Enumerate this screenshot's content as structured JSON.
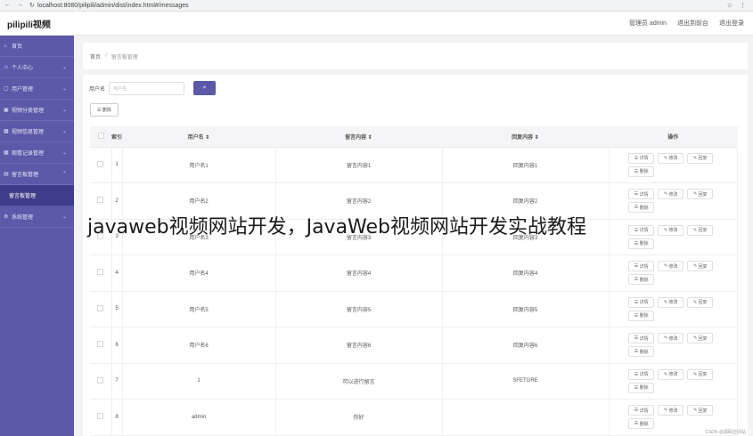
{
  "browser": {
    "url": "localhost:8080/pilipili/admin/dist/index.html#/messages"
  },
  "topbar": {
    "brand": "pilipili视频",
    "links": [
      "管理员 admin",
      "退出到前台",
      "退出登录"
    ]
  },
  "sidebar": {
    "items": [
      {
        "label": "首页",
        "chev": ""
      },
      {
        "label": "个人中心",
        "chev": "⌄"
      },
      {
        "label": "用户管理",
        "chev": "⌄"
      },
      {
        "label": "视频分类管理",
        "chev": "⌄"
      },
      {
        "label": "视频信息管理",
        "chev": "⌄"
      },
      {
        "label": "观看记录管理",
        "chev": "⌄"
      },
      {
        "label": "留言板管理",
        "chev": "⌃"
      },
      {
        "label": "留言板管理",
        "chev": ""
      },
      {
        "label": "系统管理",
        "chev": "⌄"
      }
    ]
  },
  "breadcrumb": {
    "home": "首页",
    "sep": "/",
    "current": "留言板管理"
  },
  "search": {
    "label": "用户名",
    "placeholder": "用户名"
  },
  "toolbar": {
    "delete_label": "删除"
  },
  "table": {
    "headers": [
      "索引",
      "用户名 ⇕",
      "留言内容 ⇕",
      "回复内容 ⇕",
      "操作"
    ],
    "op_labels": {
      "detail": "详情",
      "edit": "修改",
      "reply": "回复",
      "delete": "删除"
    },
    "rows": [
      {
        "index": "1",
        "user": "用户名1",
        "message": "留言内容1",
        "reply": "回复内容1"
      },
      {
        "index": "2",
        "user": "用户名2",
        "message": "留言内容2",
        "reply": "回复内容2"
      },
      {
        "index": "3",
        "user": "用户名3",
        "message": "留言内容3",
        "reply": "回复内容3"
      },
      {
        "index": "4",
        "user": "用户名4",
        "message": "留言内容4",
        "reply": "回复内容4"
      },
      {
        "index": "5",
        "user": "用户名5",
        "message": "留言内容5",
        "reply": "回复内容5"
      },
      {
        "index": "6",
        "user": "用户名6",
        "message": "留言内容6",
        "reply": "回复内容6"
      },
      {
        "index": "7",
        "user": "1",
        "message": "可以进行留言",
        "reply": "SFETGRE"
      },
      {
        "index": "8",
        "user": "admin",
        "message": "你好",
        "reply": ""
      }
    ]
  },
  "watermark": "javaweb视频网站开发，JavaWeb视频网站开发实战教程",
  "csdn": "CSDN @源码空间站",
  "colors": {
    "sidebar": "#5b59a8",
    "sidebar_active": "#3f3d8a",
    "accent": "#5b59a8"
  }
}
